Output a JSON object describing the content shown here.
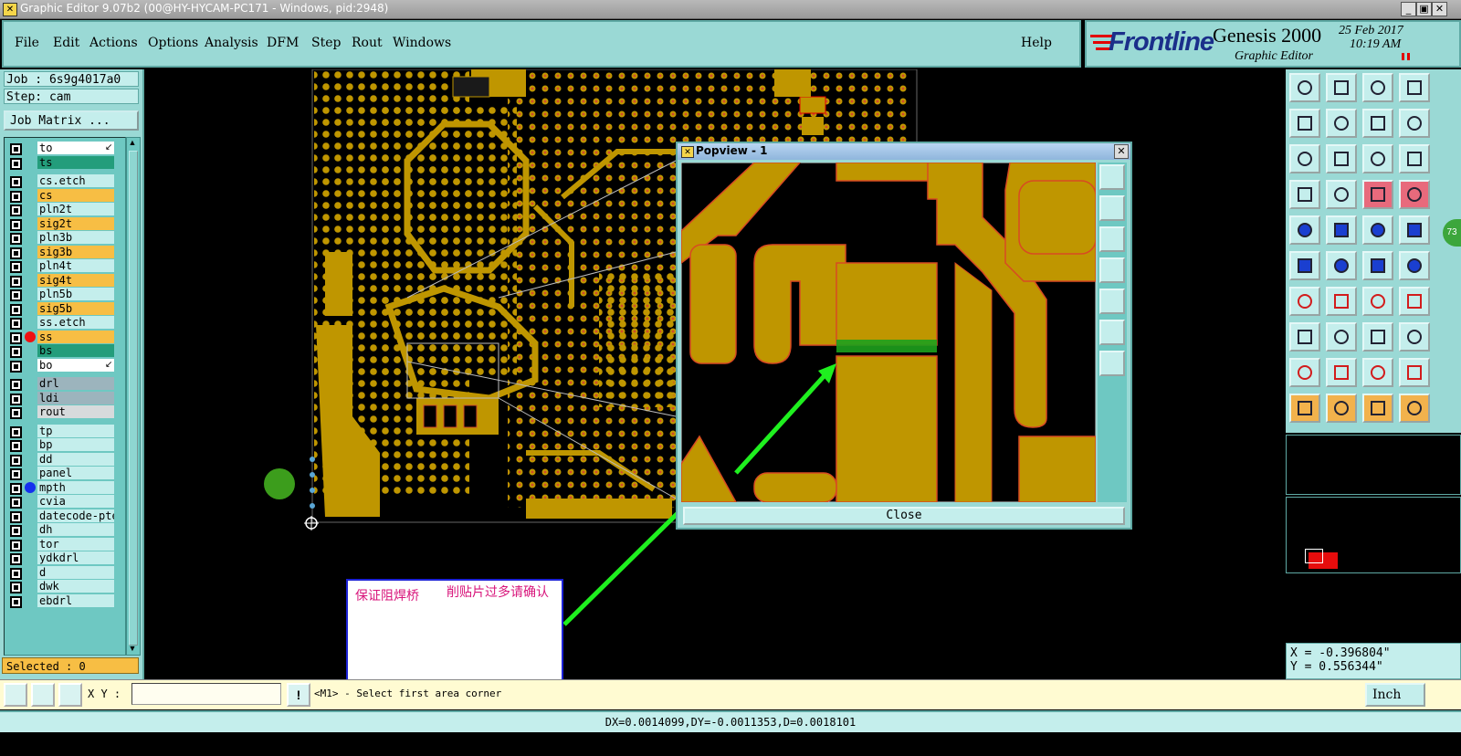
{
  "titlebar": {
    "title": "Graphic Editor 9.07b2 (00@HY-HYCAM-PC171 - Windows, pid:2948)"
  },
  "menu": {
    "items": [
      "File",
      "Edit",
      "Actions",
      "Options",
      "Analysis",
      "DFM",
      "Step",
      "Rout",
      "Windows"
    ],
    "help": "Help"
  },
  "brand": {
    "logo": "Frontline",
    "product": "Genesis 2000",
    "subtitle": "Graphic Editor",
    "date": "25 Feb 2017",
    "time": "10:19 AM"
  },
  "job": {
    "job_label": "Job : 6s9g4017a0",
    "step_label": "Step: cam",
    "matrix_button": "Job Matrix ..."
  },
  "layers": [
    {
      "name": "to",
      "color": "#ffffff",
      "marker": "",
      "arrow": true
    },
    {
      "name": "ts",
      "color": "#239d7b",
      "marker": ""
    },
    {
      "name": "cs.etch",
      "color": "#c4eeec",
      "marker": ""
    },
    {
      "name": "cs",
      "color": "#f7be44",
      "marker": ""
    },
    {
      "name": "pln2t",
      "color": "#c4eeec",
      "marker": ""
    },
    {
      "name": "sig2t",
      "color": "#f7be44",
      "marker": ""
    },
    {
      "name": "pln3b",
      "color": "#c4eeec",
      "marker": ""
    },
    {
      "name": "sig3b",
      "color": "#f7be44",
      "marker": ""
    },
    {
      "name": "pln4t",
      "color": "#c4eeec",
      "marker": ""
    },
    {
      "name": "sig4t",
      "color": "#f7be44",
      "marker": ""
    },
    {
      "name": "pln5b",
      "color": "#c4eeec",
      "marker": ""
    },
    {
      "name": "sig5b",
      "color": "#f7be44",
      "marker": ""
    },
    {
      "name": "ss.etch",
      "color": "#c4eeec",
      "marker": ""
    },
    {
      "name": "ss",
      "color": "#f7be44",
      "marker": "#ee1111"
    },
    {
      "name": "bs",
      "color": "#239d7b",
      "marker": ""
    },
    {
      "name": "bo",
      "color": "#ffffff",
      "marker": "",
      "arrow": true
    },
    {
      "name": "drl",
      "color": "#9cb4bd",
      "marker": ""
    },
    {
      "name": "ldi",
      "color": "#9cb4bd",
      "marker": ""
    },
    {
      "name": "rout",
      "color": "#d7dadc",
      "marker": ""
    },
    {
      "name": "tp",
      "color": "#c4eeec",
      "marker": ""
    },
    {
      "name": "bp",
      "color": "#c4eeec",
      "marker": ""
    },
    {
      "name": "dd",
      "color": "#c4eeec",
      "marker": ""
    },
    {
      "name": "panel",
      "color": "#c4eeec",
      "marker": ""
    },
    {
      "name": "mpth",
      "color": "#c4eeec",
      "marker": "#1530ee"
    },
    {
      "name": "cvia",
      "color": "#c4eeec",
      "marker": ""
    },
    {
      "name": "datecode-pte",
      "color": "#c4eeec",
      "marker": ""
    },
    {
      "name": "dh",
      "color": "#c4eeec",
      "marker": ""
    },
    {
      "name": "tor",
      "color": "#c4eeec",
      "marker": ""
    },
    {
      "name": "ydkdrl",
      "color": "#c4eeec",
      "marker": ""
    },
    {
      "name": "d",
      "color": "#c4eeec",
      "marker": ""
    },
    {
      "name": "dwk",
      "color": "#c4eeec",
      "marker": ""
    },
    {
      "name": "ebdrl",
      "color": "#c4eeec",
      "marker": ""
    }
  ],
  "status": {
    "selected": "Selected : 0"
  },
  "popview": {
    "title": "Popview - 1",
    "close": "Close"
  },
  "annotation": {
    "text_a": "保证阻焊桥",
    "text_b": "削贴片过多请确认"
  },
  "coords": {
    "x": "X = -0.396804\"",
    "y": "Y = 0.556344\""
  },
  "toolbar_badge": "73",
  "command": {
    "xy_label": "X Y :",
    "xy_value": "",
    "prompt": "<M1> - Select first area corner",
    "units": "Inch"
  },
  "statusline": {
    "text": "DX=0.0014099,DY=-0.0011353,D=0.0018101"
  },
  "colors": {
    "panel": "#9ad9d5",
    "copper": "#bf9600",
    "accent_red": "#e20000"
  }
}
